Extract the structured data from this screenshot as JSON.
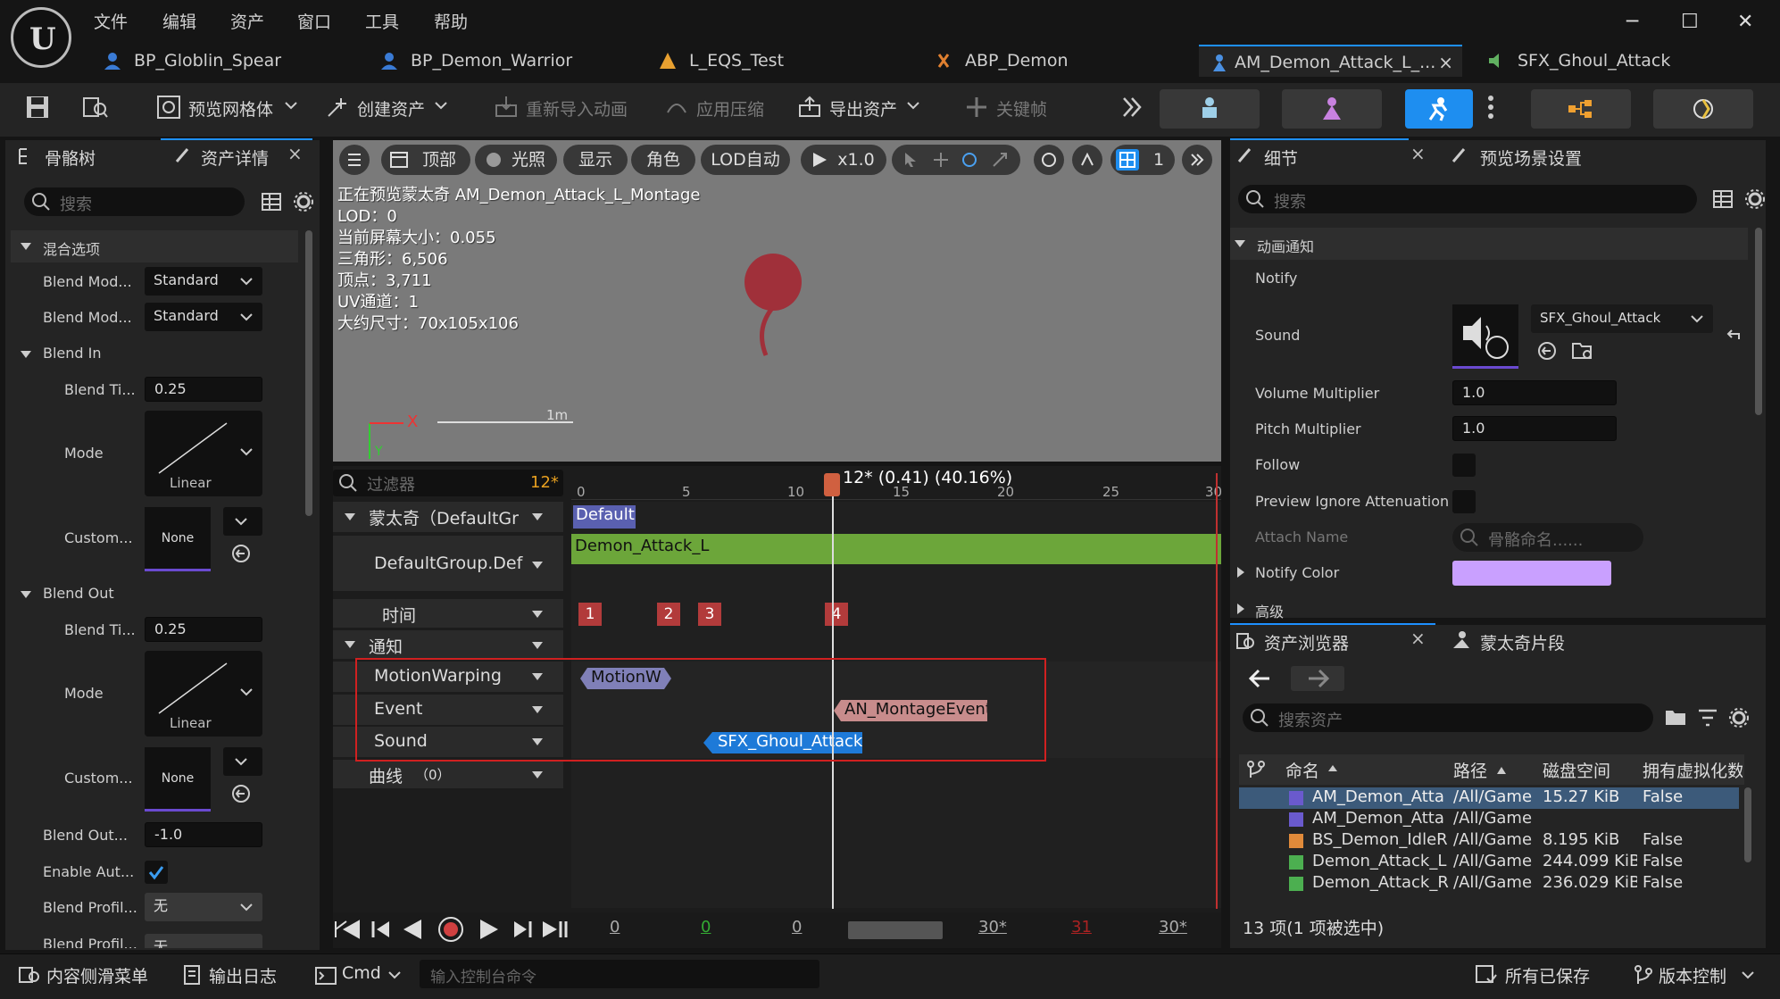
{
  "menu": [
    "文件",
    "编辑",
    "资产",
    "窗口",
    "工具",
    "帮助"
  ],
  "tabs": [
    {
      "label": "BP_Globlin_Spear",
      "icon": "person-icon",
      "color": "#3a7bd5"
    },
    {
      "label": "BP_Demon_Warrior",
      "icon": "person-icon",
      "color": "#3a7bd5"
    },
    {
      "label": "L_EQS_Test",
      "icon": "cone-icon",
      "color": "#e8a030"
    },
    {
      "label": "ABP_Demon",
      "icon": "walk-icon",
      "color": "#e08030"
    },
    {
      "label": "AM_Demon_Attack_L_...",
      "icon": "montage-icon",
      "color": "#4a90e2"
    },
    {
      "label": "SFX_Ghoul_Attack",
      "icon": "sound-icon",
      "color": "#60b060"
    }
  ],
  "tab_close": "×",
  "window": {
    "min": "─",
    "max": "☐",
    "close": "✕"
  },
  "toolbar": {
    "preview_mesh": "预览网格体",
    "create_asset": "创建资产",
    "reimport": "重新导入动画",
    "apply_compress": "应用压缩",
    "export_asset": "导出资产",
    "keyframe": "关键帧"
  },
  "left": {
    "tab1": "骨骼树",
    "tab2": "资产详情",
    "close": "×",
    "search": "搜索",
    "cat_blend": "混合选项",
    "blend_mode1": {
      "label": "Blend Mod...",
      "value": "Standard"
    },
    "blend_mode2": {
      "label": "Blend Mod...",
      "value": "Standard"
    },
    "blend_in": "Blend In",
    "blend_in_time": {
      "label": "Blend Ti...",
      "value": "0.25"
    },
    "mode1": {
      "label": "Mode",
      "value": "Linear"
    },
    "custom1": {
      "label": "Custom...",
      "value": "None"
    },
    "blend_out": "Blend Out",
    "blend_out_time": {
      "label": "Blend Ti...",
      "value": "0.25"
    },
    "mode2": {
      "label": "Mode",
      "value": "Linear"
    },
    "custom2": {
      "label": "Custom...",
      "value": "None"
    },
    "blend_out_trigger": {
      "label": "Blend Out...",
      "value": "-1.0"
    },
    "enable_auto": {
      "label": "Enable Aut...",
      "checked": true
    },
    "blend_profile1": {
      "label": "Blend Profil...",
      "value": "无"
    },
    "blend_profile2": {
      "label": "Blend Profil...",
      "value": "无"
    }
  },
  "viewport": {
    "btn_top": "顶部",
    "btn_light": "光照",
    "btn_show": "显示",
    "btn_char": "角色",
    "btn_lod": "LOD自动",
    "btn_speed": "x1.0",
    "btn_num": "1",
    "info": [
      "正在预览蒙太奇 AM_Demon_Attack_L_Montage",
      "LOD：0",
      "当前屏幕大小：0.055",
      "三角形：6,506",
      "顶点：3,711",
      "UV通道：1",
      "大约尺寸：70x105x106"
    ],
    "axis_x": "X",
    "axis_y": "Y",
    "scale": "1m"
  },
  "timeline": {
    "filter": "过滤器",
    "frame_count": "12*",
    "ruler": [
      "0",
      "5",
      "10",
      "15",
      "20",
      "25",
      "30"
    ],
    "playhead": "12* (0.41) (40.16%)",
    "montage_row": "蒙太奇（DefaultGr",
    "default_group": "DefaultGroup.Def",
    "time_row": "时间",
    "notify_row": "通知",
    "tracks": [
      "MotionWarping",
      "Event",
      "Sound"
    ],
    "curve_row": "曲线",
    "curve_count": "（0）",
    "seg_default": "Default",
    "seg_anim": "Demon_Attack_L",
    "markers": [
      "1",
      "2",
      "3",
      "4"
    ],
    "notifies": {
      "motion": "MotionW",
      "event": "AN_MontageEvent",
      "sound": "SFX_Ghoul_Attack"
    },
    "bottom_nums": [
      "0",
      "0",
      "0",
      "30*",
      "31",
      "30*"
    ]
  },
  "details": {
    "tab1": "细节",
    "tab2": "预览场景设置",
    "close": "×",
    "search": "搜索",
    "cat_notify": "动画通知",
    "notify": "Notify",
    "sound": {
      "label": "Sound",
      "value": "SFX_Ghoul_Attack"
    },
    "volume": {
      "label": "Volume Multiplier",
      "value": "1.0"
    },
    "pitch": {
      "label": "Pitch Multiplier",
      "value": "1.0"
    },
    "follow": "Follow",
    "preview_ignore": "Preview Ignore Attenuation",
    "attach": {
      "label": "Attach Name",
      "placeholder": "骨骼命名......"
    },
    "notify_color": {
      "label": "Notify Color",
      "color": "#c9a0ff"
    },
    "advanced": "高级"
  },
  "browser": {
    "tab1": "资产浏览器",
    "tab2": "蒙太奇片段",
    "close": "×",
    "search": "搜索资产",
    "cols": [
      "命名",
      "路径",
      "磁盘空间",
      "拥有虚拟化数"
    ],
    "rows": [
      {
        "name": "AM_Demon_Atta",
        "path": "/All/Game",
        "size": "15.27 KiB",
        "virt": "False",
        "color": "#6a5acd",
        "selected": true
      },
      {
        "name": "AM_Demon_Atta",
        "path": "/All/Game",
        "size": "",
        "virt": "",
        "color": "#6a5acd",
        "selected": false
      },
      {
        "name": "BS_Demon_IdleR",
        "path": "/All/Game",
        "size": "8.195 KiB",
        "virt": "False",
        "color": "#e08a3a",
        "selected": false
      },
      {
        "name": "Demon_Attack_L",
        "path": "/All/Game",
        "size": "244.099 KiB",
        "virt": "False",
        "color": "#4caf50",
        "selected": false
      },
      {
        "name": "Demon_Attack_R",
        "path": "/All/Game",
        "size": "236.029 KiB",
        "virt": "False",
        "color": "#4caf50",
        "selected": false
      }
    ],
    "count": "13 项(1 项被选中)"
  },
  "statusbar": {
    "drawer": "内容侧滑菜单",
    "log": "输出日志",
    "cmd": "Cmd",
    "console_placeholder": "输入控制台命令",
    "saved": "所有已保存",
    "vcs": "版本控制"
  }
}
